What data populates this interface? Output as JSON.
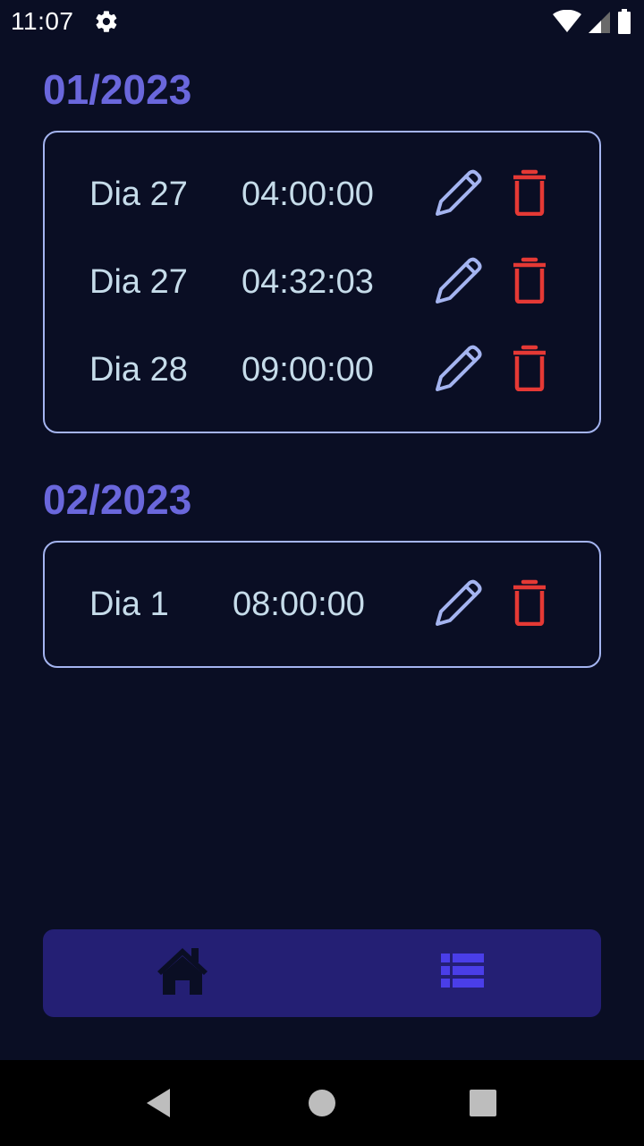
{
  "status_bar": {
    "time": "11:07",
    "icons": [
      "gear-icon",
      "wifi-icon",
      "cell-signal-icon",
      "battery-icon"
    ]
  },
  "months": [
    {
      "title": "01/2023",
      "entries": [
        {
          "day": "Dia 27",
          "time": "04:00:00"
        },
        {
          "day": "Dia 27",
          "time": "04:32:03"
        },
        {
          "day": "Dia 28",
          "time": "09:00:00"
        }
      ]
    },
    {
      "title": "02/2023",
      "entries": [
        {
          "day": "Dia 1",
          "time": "08:00:00"
        }
      ]
    }
  ],
  "row_actions": {
    "edit_icon": "pencil-icon",
    "delete_icon": "trash-icon"
  },
  "tab_bar": {
    "tabs": [
      {
        "icon": "home-icon",
        "active": false
      },
      {
        "icon": "list-icon",
        "active": true
      }
    ]
  },
  "nav_bar": {
    "icons": [
      "back-icon",
      "home-circle-icon",
      "recents-icon"
    ]
  },
  "colors": {
    "background": "#0a0e24",
    "month_title": "#6a67dc",
    "entry_text": "#c6dcea",
    "card_border": "#a4b4f0",
    "edit_icon": "#a4b4f0",
    "delete_icon": "#e53935",
    "tab_bar": "#241f74",
    "tab_active": "#4a3ee8",
    "tab_inactive": "#0a0e24"
  }
}
